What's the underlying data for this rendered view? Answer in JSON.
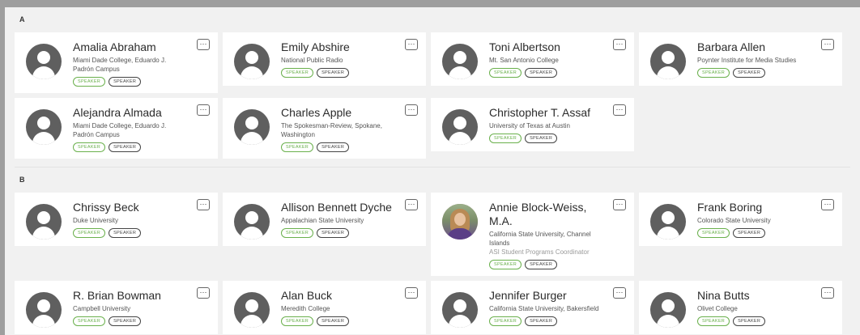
{
  "sections": [
    {
      "letter": "A",
      "people": [
        {
          "name": "Amalia Abraham",
          "org": "Miami Dade College, Eduardo J. Padrón Campus",
          "tags": [
            "SPEAKER",
            "SPEAKER"
          ]
        },
        {
          "name": "Emily Abshire",
          "org": "National Public Radio",
          "tags": [
            "SPEAKER",
            "SPEAKER"
          ]
        },
        {
          "name": "Toni Albertson",
          "org": "Mt. San Antonio College",
          "tags": [
            "SPEAKER",
            "SPEAKER"
          ]
        },
        {
          "name": "Barbara Allen",
          "org": "Poynter Institute for Media Studies",
          "tags": [
            "SPEAKER",
            "SPEAKER"
          ]
        },
        {
          "name": "Alejandra Almada",
          "org": "Miami Dade College, Eduardo J. Padrón Campus",
          "tags": [
            "SPEAKER",
            "SPEAKER"
          ]
        },
        {
          "name": "Charles Apple",
          "org": "The Spokesman-Review, Spokane, Washington",
          "tags": [
            "SPEAKER",
            "SPEAKER"
          ]
        },
        {
          "name": "Christopher T. Assaf",
          "org": "University of Texas at Austin",
          "tags": [
            "SPEAKER",
            "SPEAKER"
          ]
        }
      ]
    },
    {
      "letter": "B",
      "people": [
        {
          "name": "Chrissy Beck",
          "org": "Duke University",
          "tags": [
            "SPEAKER",
            "SPEAKER"
          ]
        },
        {
          "name": "Allison Bennett Dyche",
          "org": "Appalachian State University",
          "tags": [
            "SPEAKER",
            "SPEAKER"
          ]
        },
        {
          "name": "Annie Block-Weiss, M.A.",
          "org": "California State University, Channel Islands",
          "role": "ASI Student Programs Coordinator",
          "photo": true,
          "tags": [
            "SPEAKER",
            "SPEAKER"
          ]
        },
        {
          "name": "Frank Boring",
          "org": "Colorado State University",
          "tags": [
            "SPEAKER",
            "SPEAKER"
          ]
        },
        {
          "name": "R. Brian Bowman",
          "org": "Campbell University",
          "tags": [
            "SPEAKER",
            "SPEAKER"
          ]
        },
        {
          "name": "Alan Buck",
          "org": "Meredith College",
          "tags": [
            "SPEAKER",
            "SPEAKER"
          ]
        },
        {
          "name": "Jennifer Burger",
          "org": "California State University, Bakersfield",
          "tags": [
            "SPEAKER",
            "SPEAKER"
          ]
        },
        {
          "name": "Nina Butts",
          "org": "Olivet College",
          "tags": [
            "SPEAKER",
            "SPEAKER"
          ]
        }
      ]
    }
  ],
  "more_button_label": "···",
  "colors": {
    "speaker_green": "#6ab04c",
    "avatar_gray": "#5f5f5f"
  }
}
